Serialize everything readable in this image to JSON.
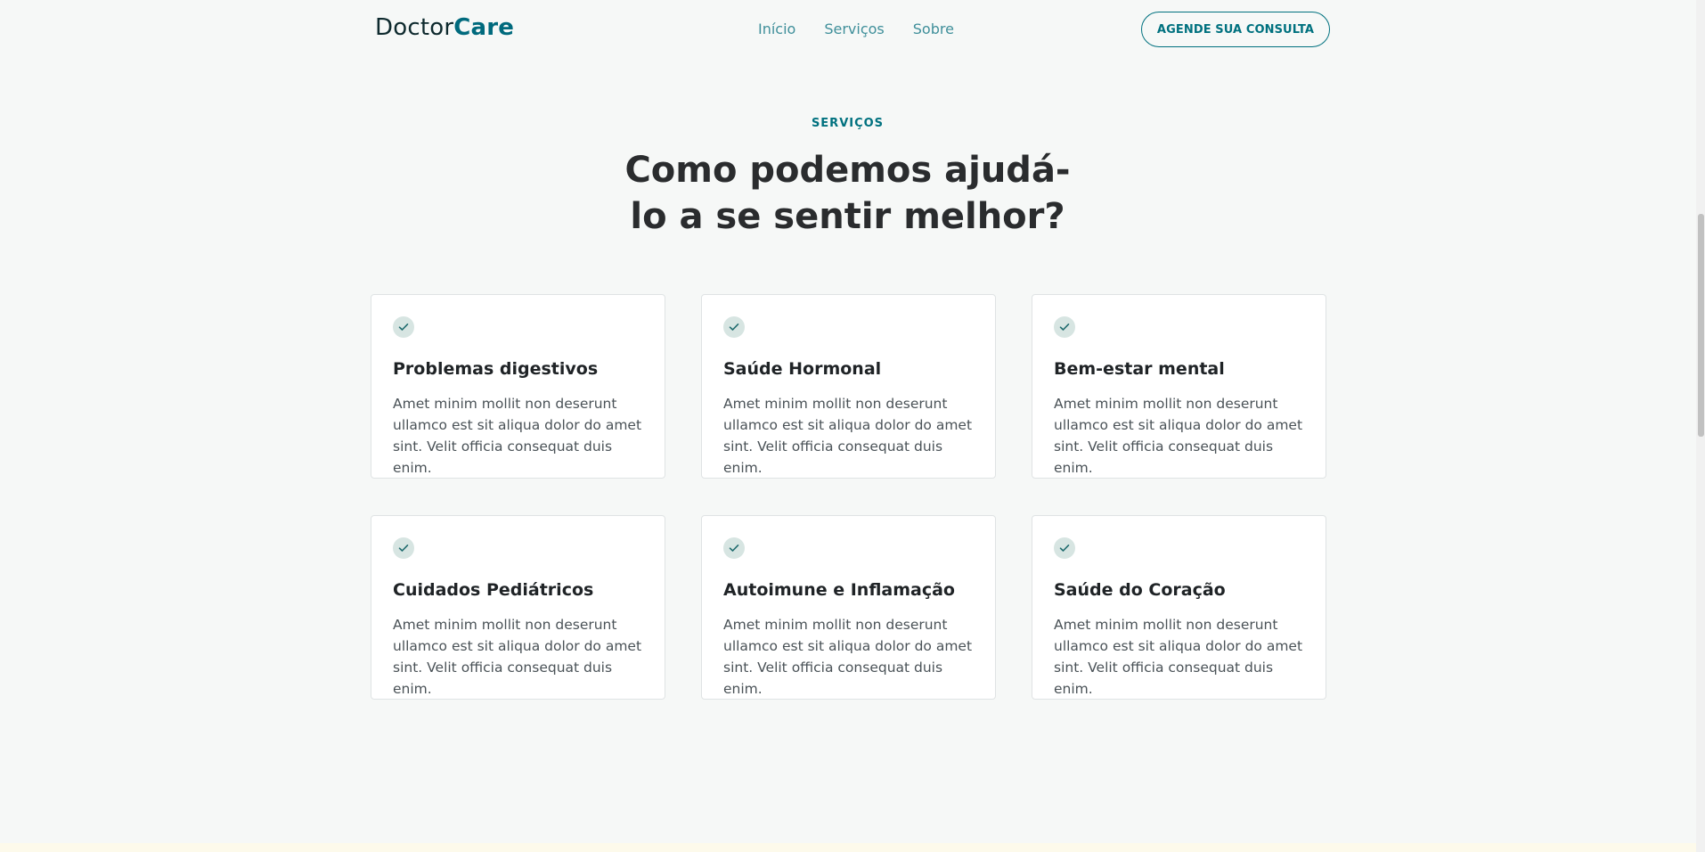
{
  "header": {
    "logo_part1": "Doctor",
    "logo_part2": "Care",
    "nav": [
      {
        "label": "Início"
      },
      {
        "label": "Serviços"
      },
      {
        "label": "Sobre"
      }
    ],
    "cta_label": "AGENDE SUA CONSULTA"
  },
  "section": {
    "eyebrow": "SERVIÇOS",
    "headline_line1": "Como podemos ajudá-",
    "headline_line2": "lo a se sentir melhor?"
  },
  "cards": [
    {
      "title": "Problemas digestivos",
      "text": "Amet minim mollit non deserunt ullamco est sit aliqua dolor do amet sint. Velit officia consequat duis enim."
    },
    {
      "title": "Saúde Hormonal",
      "text": "Amet minim mollit non deserunt ullamco est sit aliqua dolor do amet sint. Velit officia consequat duis enim."
    },
    {
      "title": "Bem-estar mental",
      "text": "Amet minim mollit non deserunt ullamco est sit aliqua dolor do amet sint. Velit officia consequat duis enim."
    },
    {
      "title": "Cuidados Pediátricos",
      "text": "Amet minim mollit non deserunt ullamco est sit aliqua dolor do amet sint. Velit officia consequat duis enim."
    },
    {
      "title": "Autoimune e Inflamação",
      "text": "Amet minim mollit non deserunt ullamco est sit aliqua dolor do amet sint. Velit officia consequat duis enim."
    },
    {
      "title": "Saúde do Coração",
      "text": "Amet minim mollit non deserunt ullamco est sit aliqua dolor do amet sint. Velit officia consequat duis enim."
    }
  ],
  "icons": {
    "card_icon": "check-icon"
  },
  "colors": {
    "brand": "#006a7d",
    "background": "#f6f8f7",
    "check_bg": "#d7e5e2"
  }
}
